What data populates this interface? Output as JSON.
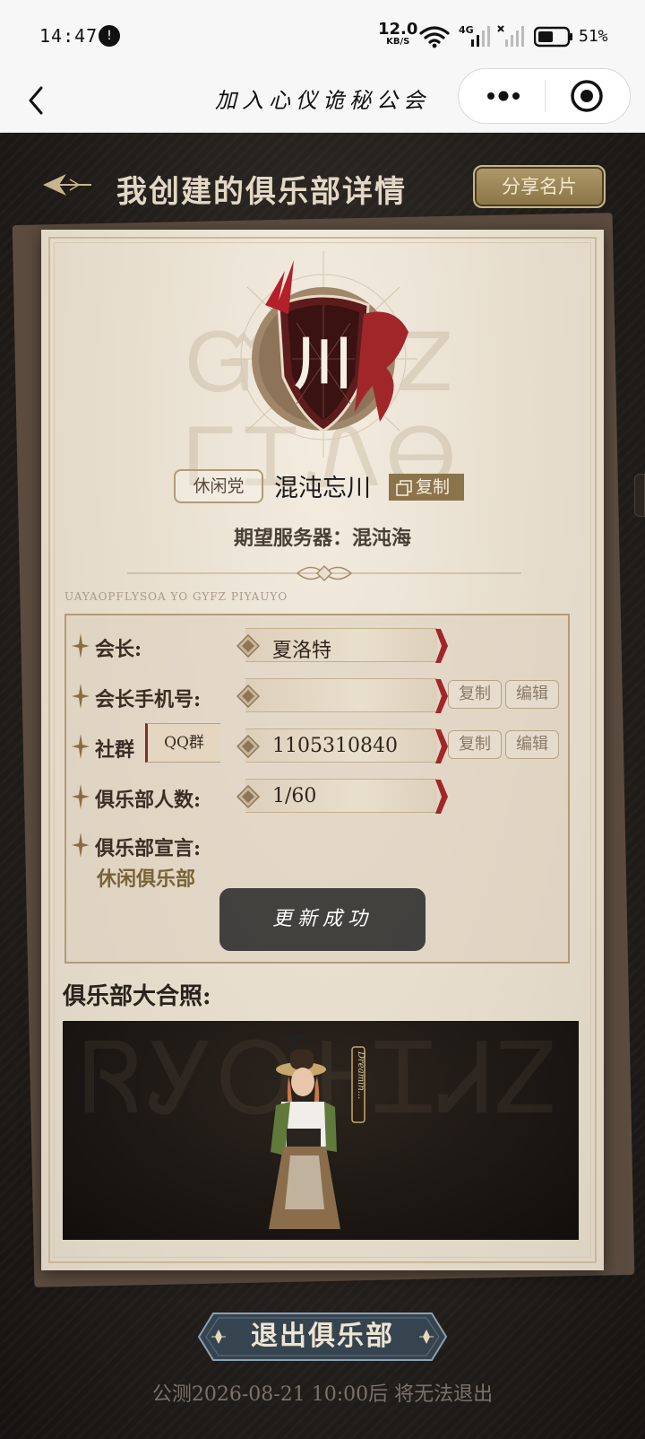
{
  "status_bar": {
    "time": "14:47",
    "notification_badge": "!",
    "net_speed_value": "12.0",
    "net_speed_unit": "KB/S",
    "network_label": "4G",
    "battery": "51%"
  },
  "nav": {
    "title": "加入心仪诡秘公会"
  },
  "page": {
    "title": "我创建的俱乐部详情",
    "share_label": "分享名片"
  },
  "club": {
    "emblem_char": "川",
    "tag": "休闲党",
    "name": "混沌忘川",
    "copy_label": "复制",
    "server_line": "期望服务器：混沌海",
    "tiny_script": "UAYAOPFLYSOA YO GYFZ PIYAUYO",
    "bg_glyphs": "ᏳᏆᎬᏃ ᎱᏆᏁᎾ"
  },
  "info": {
    "leader_label": "会长:",
    "leader_value": "夏洛特",
    "phone_label": "会长手机号:",
    "phone_value": "",
    "copy_label": "复制",
    "edit_label": "编辑",
    "group_label": "社群",
    "group_type": "QQ群",
    "group_value": "1105310840",
    "members_label": "俱乐部人数:",
    "members_value": "1/60",
    "motto_label": "俱乐部宣言:",
    "motto_value": "休闲俱乐部"
  },
  "photo": {
    "title": "俱乐部大合照:",
    "glyphs": "ᏒᎩᎤᎰᏆᏗᏃ",
    "name_plate": "Dreamin..."
  },
  "toast": {
    "message": "更新成功"
  },
  "footer": {
    "quit_label": "退出俱乐部",
    "deadline": "公测2026-08-21 10:00后 将无法退出"
  },
  "colors": {
    "accent_gold": "#8c744a",
    "accent_red": "#a1262a",
    "card_bg": "#e8dfcf",
    "dark_bg": "#24201c"
  }
}
